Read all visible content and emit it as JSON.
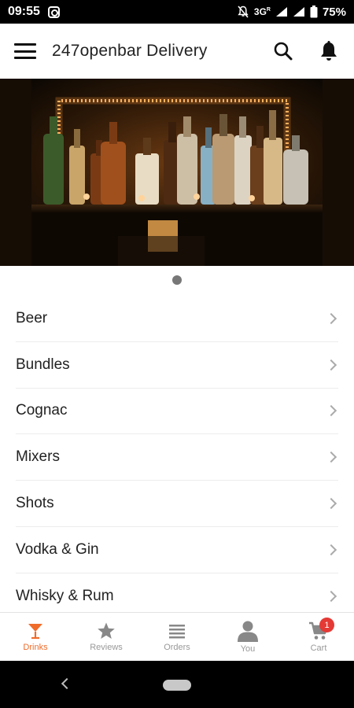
{
  "status_bar": {
    "time": "09:55",
    "network": "3G",
    "network_sup": "R",
    "battery": "75%"
  },
  "app_bar": {
    "title": "247openbar Delivery",
    "menu_icon": "hamburger-menu-icon",
    "search_icon": "search-icon",
    "notification_icon": "bell-icon"
  },
  "banner": {
    "image": "bar shelf with liquor bottles and string lights"
  },
  "categories": [
    {
      "label": "Beer"
    },
    {
      "label": "Bundles"
    },
    {
      "label": "Cognac"
    },
    {
      "label": "Mixers"
    },
    {
      "label": "Shots"
    },
    {
      "label": "Vodka & Gin"
    },
    {
      "label": "Whisky & Rum"
    }
  ],
  "bottom_nav": {
    "items": [
      {
        "label": "Drinks",
        "icon": "cocktail-glass-icon",
        "active": true
      },
      {
        "label": "Reviews",
        "icon": "star-icon",
        "active": false
      },
      {
        "label": "Orders",
        "icon": "list-icon",
        "active": false
      },
      {
        "label": "You",
        "icon": "person-icon",
        "active": false
      },
      {
        "label": "Cart",
        "icon": "cart-icon",
        "active": false,
        "badge": "1"
      }
    ]
  },
  "colors": {
    "accent": "#ef6c2b",
    "inactive": "#999999",
    "badge": "#e53935"
  }
}
